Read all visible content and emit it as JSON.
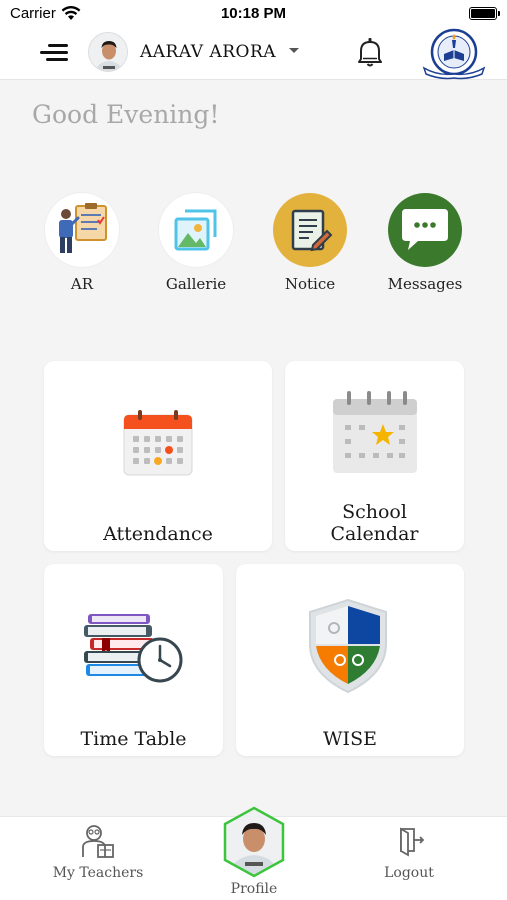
{
  "status_bar": {
    "carrier": "Carrier",
    "time": "10:18 PM"
  },
  "header": {
    "user_name": "AARAV ARORA",
    "menu_icon": "hamburger-menu-icon",
    "notification_icon": "bell-icon",
    "school_logo": "school-crest-logo"
  },
  "greeting": "Good Evening!",
  "quick_actions": [
    {
      "label": "AR",
      "icon": "presentation-board-icon"
    },
    {
      "label": "Gallerie",
      "icon": "gallery-icon",
      "color": "#4fc3e8"
    },
    {
      "label": "Notice",
      "icon": "notice-icon",
      "color": "#e3b23c"
    },
    {
      "label": "Messages",
      "icon": "chat-bubble-icon",
      "color": "#3b7a2c"
    }
  ],
  "cards": [
    {
      "label": "Attendance",
      "icon": "attendance-calendar-icon"
    },
    {
      "label_line1": "School",
      "label_line2": "Calendar",
      "icon": "school-calendar-icon"
    },
    {
      "label": "Time Table",
      "icon": "books-clock-icon"
    },
    {
      "label": "WISE",
      "icon": "shield-icon"
    }
  ],
  "bottom_nav": {
    "teachers": "My Teachers",
    "profile": "Profile",
    "logout": "Logout",
    "active_color": "#3cc43c"
  }
}
